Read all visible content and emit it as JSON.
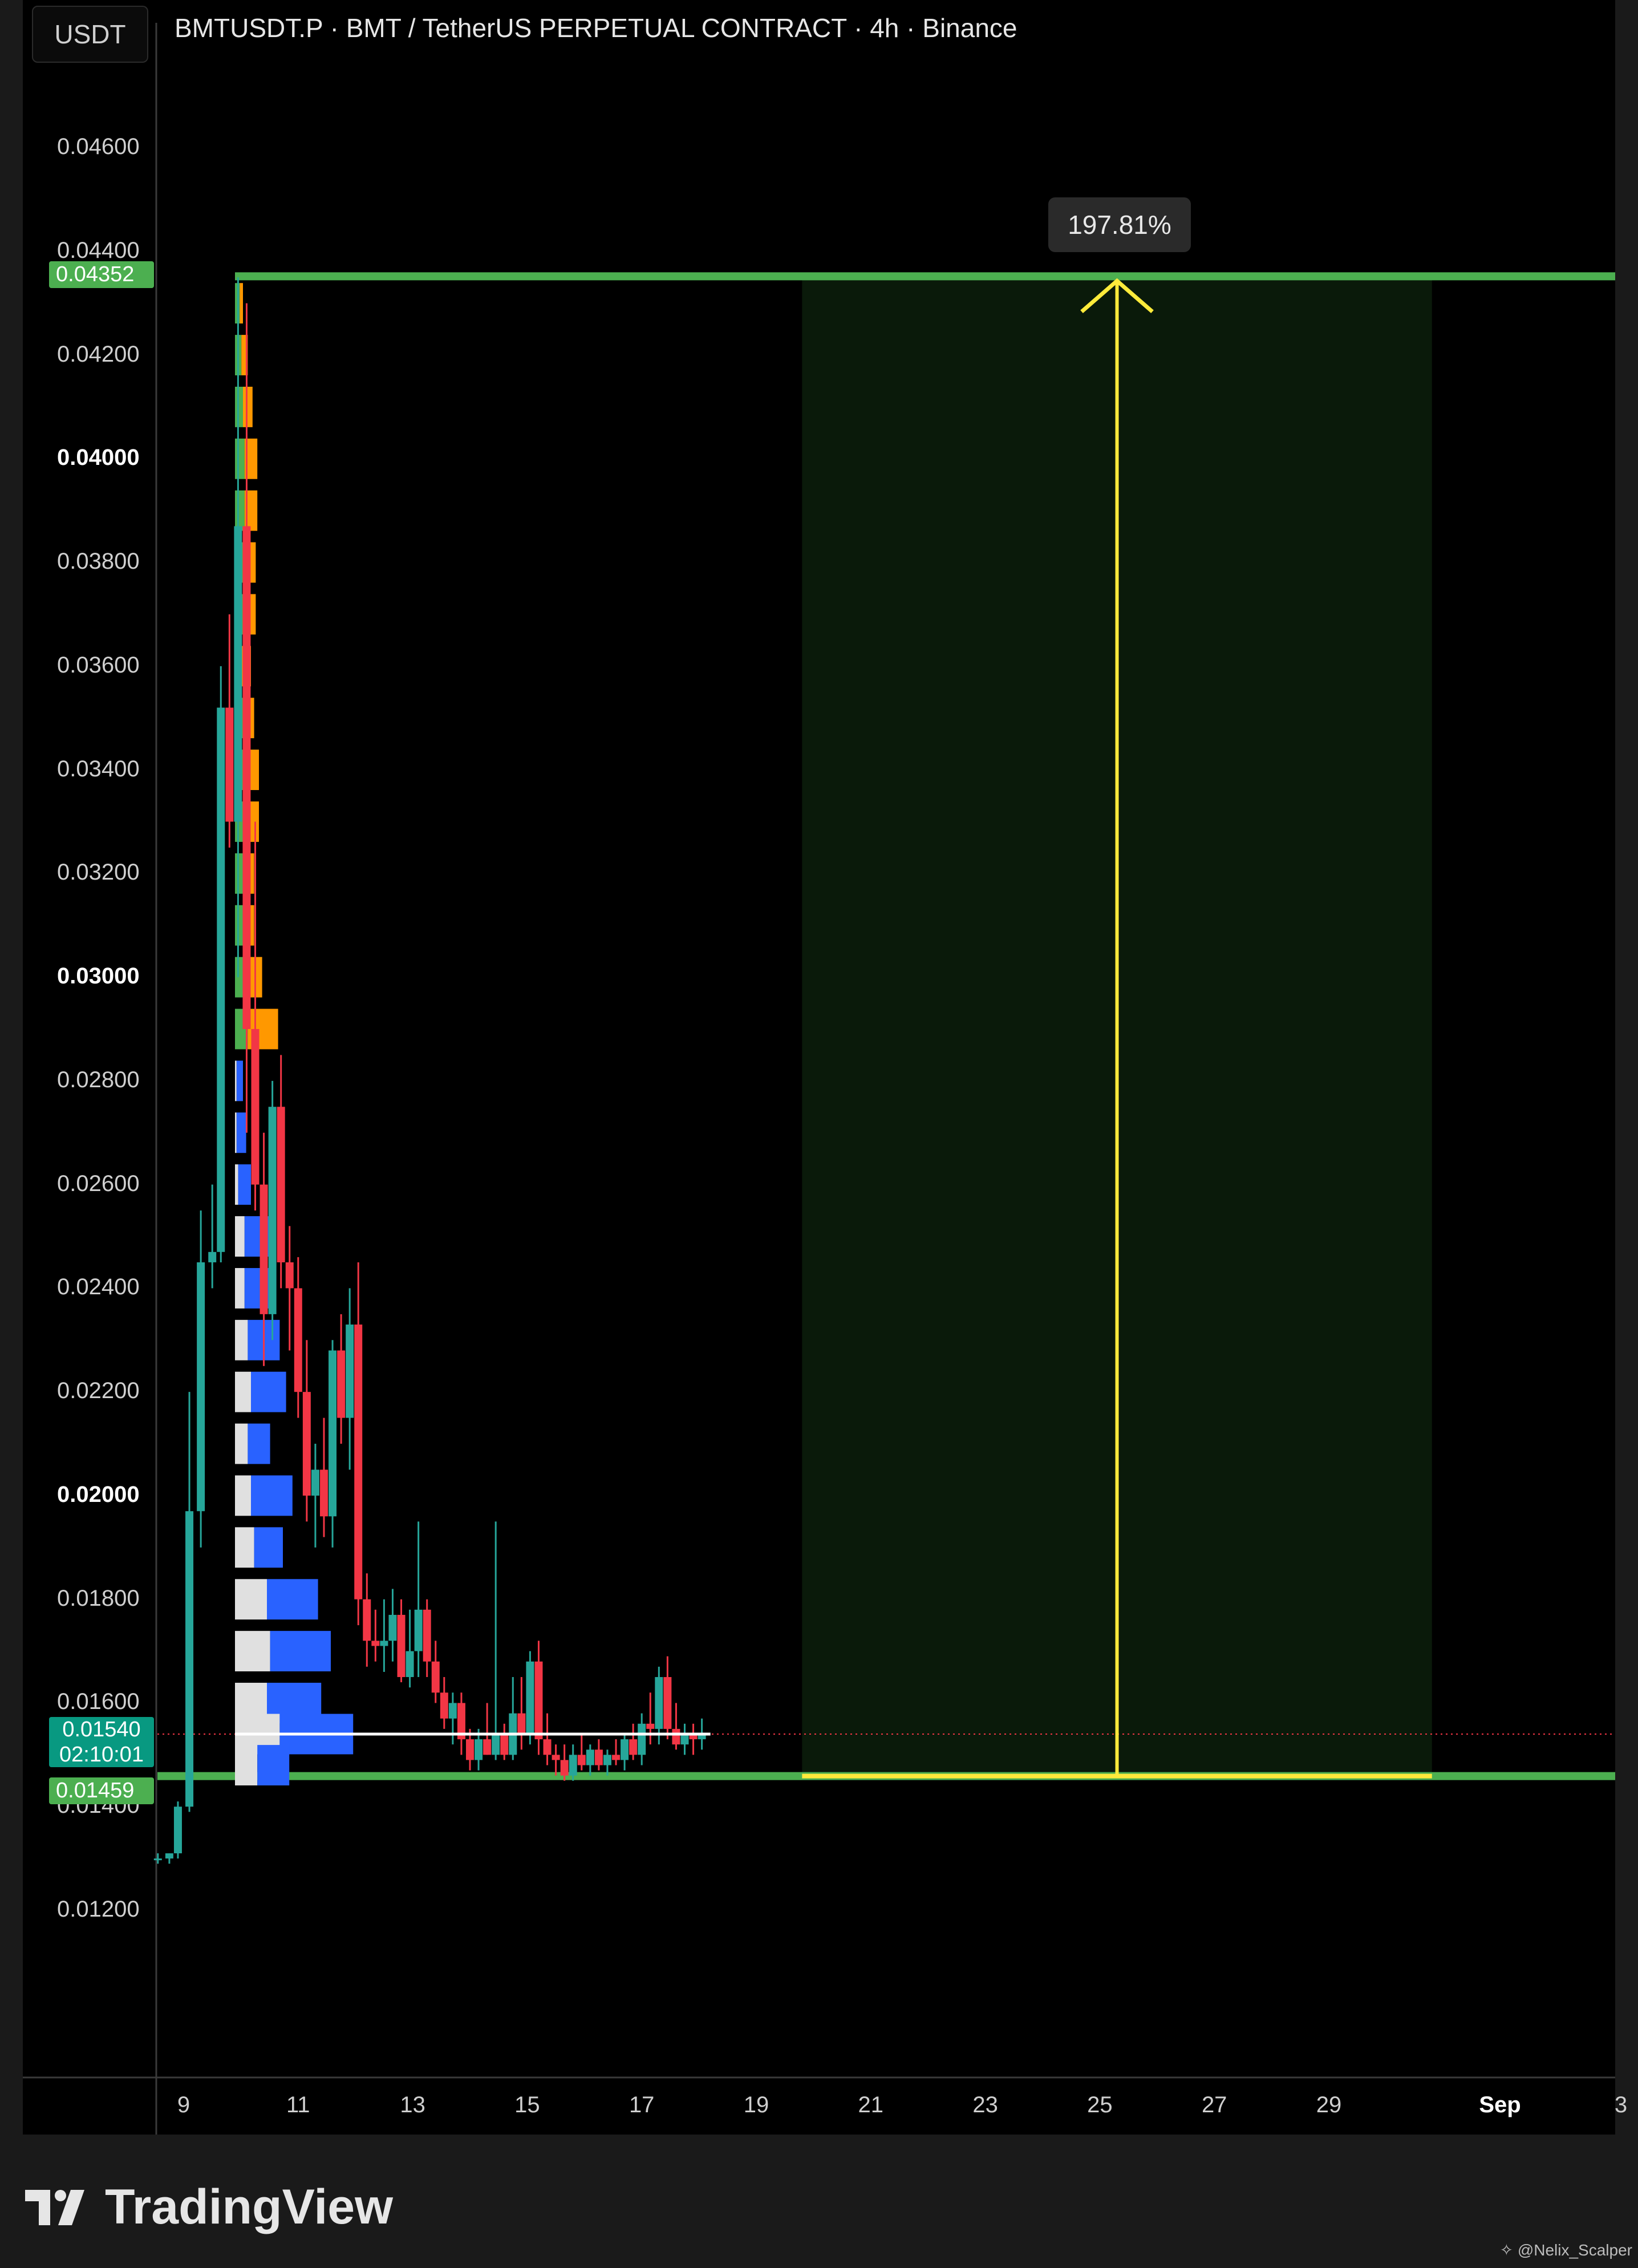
{
  "header": {
    "currency": "USDT",
    "title": "BMTUSDT.P · BMT / TetherUS PERPETUAL CONTRACT · 4h · Binance"
  },
  "chart_data": {
    "type": "candlestick",
    "title": "BMTUSDT.P · BMT / TetherUS PERPETUAL CONTRACT · 4h · Binance",
    "ylim": [
      0.0108,
      0.047
    ],
    "y_ticks": [
      {
        "label": "0.04600",
        "value": 0.046,
        "bold": false
      },
      {
        "label": "0.04400",
        "value": 0.044,
        "bold": false
      },
      {
        "label": "0.04200",
        "value": 0.042,
        "bold": false
      },
      {
        "label": "0.04000",
        "value": 0.04,
        "bold": true
      },
      {
        "label": "0.03800",
        "value": 0.038,
        "bold": false
      },
      {
        "label": "0.03600",
        "value": 0.036,
        "bold": false
      },
      {
        "label": "0.03400",
        "value": 0.034,
        "bold": false
      },
      {
        "label": "0.03200",
        "value": 0.032,
        "bold": false
      },
      {
        "label": "0.03000",
        "value": 0.03,
        "bold": true
      },
      {
        "label": "0.02800",
        "value": 0.028,
        "bold": false
      },
      {
        "label": "0.02600",
        "value": 0.026,
        "bold": false
      },
      {
        "label": "0.02400",
        "value": 0.024,
        "bold": false
      },
      {
        "label": "0.02200",
        "value": 0.022,
        "bold": false
      },
      {
        "label": "0.02000",
        "value": 0.02,
        "bold": true
      },
      {
        "label": "0.01800",
        "value": 0.018,
        "bold": false
      },
      {
        "label": "0.01600",
        "value": 0.016,
        "bold": false
      },
      {
        "label": "0.01400",
        "value": 0.014,
        "bold": false
      },
      {
        "label": "0.01200",
        "value": 0.012,
        "bold": false
      }
    ],
    "x_ticks": [
      {
        "label": "9",
        "day": 9,
        "bold": false
      },
      {
        "label": "11",
        "day": 11,
        "bold": false
      },
      {
        "label": "13",
        "day": 13,
        "bold": false
      },
      {
        "label": "15",
        "day": 15,
        "bold": false
      },
      {
        "label": "17",
        "day": 17,
        "bold": false
      },
      {
        "label": "19",
        "day": 19,
        "bold": false
      },
      {
        "label": "21",
        "day": 21,
        "bold": false
      },
      {
        "label": "23",
        "day": 23,
        "bold": false
      },
      {
        "label": "25",
        "day": 25,
        "bold": false
      },
      {
        "label": "27",
        "day": 27,
        "bold": false
      },
      {
        "label": "29",
        "day": 29,
        "bold": false
      },
      {
        "label": "Sep",
        "day": 32,
        "bold": true
      },
      {
        "label": "3",
        "day": 34,
        "bold": false
      }
    ],
    "candles": [
      {
        "t": 8.55,
        "o": 0.013,
        "h": 0.0131,
        "l": 0.0129,
        "c": 0.013
      },
      {
        "t": 8.75,
        "o": 0.013,
        "h": 0.0131,
        "l": 0.0129,
        "c": 0.0131
      },
      {
        "t": 8.9,
        "o": 0.0131,
        "h": 0.0141,
        "l": 0.013,
        "c": 0.014
      },
      {
        "t": 9.1,
        "o": 0.014,
        "h": 0.022,
        "l": 0.0139,
        "c": 0.0197
      },
      {
        "t": 9.3,
        "o": 0.0197,
        "h": 0.0255,
        "l": 0.019,
        "c": 0.0245
      },
      {
        "t": 9.5,
        "o": 0.0245,
        "h": 0.026,
        "l": 0.024,
        "c": 0.0247
      },
      {
        "t": 9.65,
        "o": 0.0247,
        "h": 0.036,
        "l": 0.0245,
        "c": 0.0352
      },
      {
        "t": 9.8,
        "o": 0.0352,
        "h": 0.037,
        "l": 0.0325,
        "c": 0.033
      },
      {
        "t": 9.95,
        "o": 0.033,
        "h": 0.0435,
        "l": 0.03,
        "c": 0.0387
      },
      {
        "t": 10.1,
        "o": 0.0387,
        "h": 0.043,
        "l": 0.027,
        "c": 0.029
      },
      {
        "t": 10.25,
        "o": 0.029,
        "h": 0.033,
        "l": 0.0255,
        "c": 0.026
      },
      {
        "t": 10.4,
        "o": 0.026,
        "h": 0.027,
        "l": 0.0225,
        "c": 0.0235
      },
      {
        "t": 10.55,
        "o": 0.0235,
        "h": 0.028,
        "l": 0.023,
        "c": 0.0275
      },
      {
        "t": 10.7,
        "o": 0.0275,
        "h": 0.0285,
        "l": 0.024,
        "c": 0.0245
      },
      {
        "t": 10.85,
        "o": 0.0245,
        "h": 0.0252,
        "l": 0.0228,
        "c": 0.024
      },
      {
        "t": 11.0,
        "o": 0.024,
        "h": 0.0246,
        "l": 0.0215,
        "c": 0.022
      },
      {
        "t": 11.15,
        "o": 0.022,
        "h": 0.023,
        "l": 0.0195,
        "c": 0.02
      },
      {
        "t": 11.3,
        "o": 0.02,
        "h": 0.021,
        "l": 0.019,
        "c": 0.0205
      },
      {
        "t": 11.45,
        "o": 0.0205,
        "h": 0.0215,
        "l": 0.0192,
        "c": 0.0196
      },
      {
        "t": 11.6,
        "o": 0.0196,
        "h": 0.023,
        "l": 0.019,
        "c": 0.0228
      },
      {
        "t": 11.75,
        "o": 0.0228,
        "h": 0.0235,
        "l": 0.021,
        "c": 0.0215
      },
      {
        "t": 11.9,
        "o": 0.0215,
        "h": 0.024,
        "l": 0.0205,
        "c": 0.0233
      },
      {
        "t": 12.05,
        "o": 0.0233,
        "h": 0.0245,
        "l": 0.0175,
        "c": 0.018
      },
      {
        "t": 12.2,
        "o": 0.018,
        "h": 0.0185,
        "l": 0.0167,
        "c": 0.0172
      },
      {
        "t": 12.35,
        "o": 0.0172,
        "h": 0.0178,
        "l": 0.0168,
        "c": 0.0171
      },
      {
        "t": 12.5,
        "o": 0.0171,
        "h": 0.018,
        "l": 0.0166,
        "c": 0.0172
      },
      {
        "t": 12.65,
        "o": 0.0172,
        "h": 0.0182,
        "l": 0.0168,
        "c": 0.0177
      },
      {
        "t": 12.8,
        "o": 0.0177,
        "h": 0.018,
        "l": 0.0164,
        "c": 0.0165
      },
      {
        "t": 12.95,
        "o": 0.0165,
        "h": 0.0178,
        "l": 0.0163,
        "c": 0.017
      },
      {
        "t": 13.1,
        "o": 0.017,
        "h": 0.0195,
        "l": 0.0165,
        "c": 0.0178
      },
      {
        "t": 13.25,
        "o": 0.0178,
        "h": 0.018,
        "l": 0.0165,
        "c": 0.0168
      },
      {
        "t": 13.4,
        "o": 0.0168,
        "h": 0.0172,
        "l": 0.016,
        "c": 0.0162
      },
      {
        "t": 13.55,
        "o": 0.0162,
        "h": 0.0165,
        "l": 0.0155,
        "c": 0.0157
      },
      {
        "t": 13.7,
        "o": 0.0157,
        "h": 0.0162,
        "l": 0.0152,
        "c": 0.016
      },
      {
        "t": 13.85,
        "o": 0.016,
        "h": 0.0162,
        "l": 0.015,
        "c": 0.0153
      },
      {
        "t": 14.0,
        "o": 0.0153,
        "h": 0.0155,
        "l": 0.0147,
        "c": 0.0149
      },
      {
        "t": 14.15,
        "o": 0.0149,
        "h": 0.0155,
        "l": 0.0147,
        "c": 0.0153
      },
      {
        "t": 14.3,
        "o": 0.0153,
        "h": 0.016,
        "l": 0.015,
        "c": 0.015
      },
      {
        "t": 14.45,
        "o": 0.015,
        "h": 0.0195,
        "l": 0.0149,
        "c": 0.0154
      },
      {
        "t": 14.6,
        "o": 0.0154,
        "h": 0.0156,
        "l": 0.0149,
        "c": 0.015
      },
      {
        "t": 14.75,
        "o": 0.015,
        "h": 0.0165,
        "l": 0.0149,
        "c": 0.0158
      },
      {
        "t": 14.9,
        "o": 0.0158,
        "h": 0.0165,
        "l": 0.0151,
        "c": 0.0154
      },
      {
        "t": 15.05,
        "o": 0.0154,
        "h": 0.017,
        "l": 0.0152,
        "c": 0.0168
      },
      {
        "t": 15.2,
        "o": 0.0168,
        "h": 0.0172,
        "l": 0.015,
        "c": 0.0153
      },
      {
        "t": 15.35,
        "o": 0.0153,
        "h": 0.0158,
        "l": 0.0148,
        "c": 0.015
      },
      {
        "t": 15.5,
        "o": 0.015,
        "h": 0.0152,
        "l": 0.0146,
        "c": 0.0149
      },
      {
        "t": 15.65,
        "o": 0.0149,
        "h": 0.0152,
        "l": 0.0145,
        "c": 0.0146
      },
      {
        "t": 15.8,
        "o": 0.0146,
        "h": 0.0152,
        "l": 0.0145,
        "c": 0.015
      },
      {
        "t": 15.95,
        "o": 0.015,
        "h": 0.0154,
        "l": 0.0147,
        "c": 0.0148
      },
      {
        "t": 16.1,
        "o": 0.0148,
        "h": 0.0152,
        "l": 0.0146,
        "c": 0.0151
      },
      {
        "t": 16.25,
        "o": 0.0151,
        "h": 0.0153,
        "l": 0.0147,
        "c": 0.0148
      },
      {
        "t": 16.4,
        "o": 0.0148,
        "h": 0.0151,
        "l": 0.0146,
        "c": 0.015
      },
      {
        "t": 16.55,
        "o": 0.015,
        "h": 0.0153,
        "l": 0.0148,
        "c": 0.0149
      },
      {
        "t": 16.7,
        "o": 0.0149,
        "h": 0.0154,
        "l": 0.0147,
        "c": 0.0153
      },
      {
        "t": 16.85,
        "o": 0.0153,
        "h": 0.0156,
        "l": 0.0149,
        "c": 0.015
      },
      {
        "t": 17.0,
        "o": 0.015,
        "h": 0.0158,
        "l": 0.0148,
        "c": 0.0156
      },
      {
        "t": 17.15,
        "o": 0.0156,
        "h": 0.0162,
        "l": 0.0152,
        "c": 0.0155
      },
      {
        "t": 17.3,
        "o": 0.0155,
        "h": 0.0167,
        "l": 0.0152,
        "c": 0.0165
      },
      {
        "t": 17.45,
        "o": 0.0165,
        "h": 0.0169,
        "l": 0.0153,
        "c": 0.0155
      },
      {
        "t": 17.6,
        "o": 0.0155,
        "h": 0.016,
        "l": 0.0151,
        "c": 0.0152
      },
      {
        "t": 17.75,
        "o": 0.0152,
        "h": 0.0156,
        "l": 0.015,
        "c": 0.0154
      },
      {
        "t": 17.9,
        "o": 0.0154,
        "h": 0.0156,
        "l": 0.015,
        "c": 0.0153
      },
      {
        "t": 18.05,
        "o": 0.0153,
        "h": 0.0157,
        "l": 0.0151,
        "c": 0.0154
      }
    ],
    "volume_profile": [
      {
        "p": 0.043,
        "up": 0.3,
        "dn": 0.2,
        "scheme": "orange"
      },
      {
        "p": 0.042,
        "up": 0.4,
        "dn": 0.4,
        "scheme": "orange"
      },
      {
        "p": 0.041,
        "up": 0.5,
        "dn": 0.6,
        "scheme": "orange"
      },
      {
        "p": 0.04,
        "up": 0.6,
        "dn": 0.8,
        "scheme": "orange"
      },
      {
        "p": 0.039,
        "up": 0.6,
        "dn": 0.8,
        "scheme": "orange"
      },
      {
        "p": 0.038,
        "up": 0.5,
        "dn": 0.8,
        "scheme": "orange"
      },
      {
        "p": 0.037,
        "up": 0.5,
        "dn": 0.8,
        "scheme": "orange"
      },
      {
        "p": 0.036,
        "up": 0.4,
        "dn": 0.6,
        "scheme": "orange"
      },
      {
        "p": 0.035,
        "up": 0.5,
        "dn": 0.7,
        "scheme": "orange"
      },
      {
        "p": 0.034,
        "up": 0.6,
        "dn": 0.9,
        "scheme": "orange"
      },
      {
        "p": 0.033,
        "up": 0.6,
        "dn": 0.9,
        "scheme": "orange"
      },
      {
        "p": 0.032,
        "up": 0.5,
        "dn": 0.7,
        "scheme": "orange"
      },
      {
        "p": 0.031,
        "up": 0.5,
        "dn": 0.7,
        "scheme": "orange"
      },
      {
        "p": 0.03,
        "up": 0.6,
        "dn": 1.1,
        "scheme": "orange"
      },
      {
        "p": 0.029,
        "up": 0.8,
        "dn": 1.9,
        "scheme": "orange"
      },
      {
        "p": 0.028,
        "up": 0.1,
        "dn": 0.4,
        "scheme": "blue"
      },
      {
        "p": 0.027,
        "up": 0.1,
        "dn": 0.6,
        "scheme": "blue"
      },
      {
        "p": 0.026,
        "up": 0.2,
        "dn": 0.8,
        "scheme": "blue"
      },
      {
        "p": 0.025,
        "up": 0.6,
        "dn": 1.8,
        "scheme": "blue"
      },
      {
        "p": 0.024,
        "up": 0.6,
        "dn": 1.6,
        "scheme": "blue"
      },
      {
        "p": 0.023,
        "up": 0.8,
        "dn": 2.0,
        "scheme": "blue"
      },
      {
        "p": 0.022,
        "up": 1.0,
        "dn": 2.2,
        "scheme": "blue"
      },
      {
        "p": 0.021,
        "up": 0.8,
        "dn": 1.4,
        "scheme": "blue"
      },
      {
        "p": 0.02,
        "up": 1.0,
        "dn": 2.6,
        "scheme": "blue"
      },
      {
        "p": 0.019,
        "up": 1.2,
        "dn": 1.8,
        "scheme": "blue"
      },
      {
        "p": 0.018,
        "up": 2.0,
        "dn": 3.2,
        "scheme": "blue"
      },
      {
        "p": 0.017,
        "up": 2.2,
        "dn": 3.8,
        "scheme": "blue"
      },
      {
        "p": 0.016,
        "up": 2.0,
        "dn": 3.4,
        "scheme": "blue"
      },
      {
        "p": 0.0154,
        "up": 2.8,
        "dn": 4.6,
        "scheme": "blue"
      },
      {
        "p": 0.0148,
        "up": 1.4,
        "dn": 2.0,
        "scheme": "blue"
      }
    ],
    "levels": [
      {
        "name": "target",
        "price": 0.04352,
        "color": "#4CAF50"
      },
      {
        "name": "support",
        "price": 0.01459,
        "color": "#4CAF50"
      }
    ],
    "current_price": {
      "price": 0.0154,
      "countdown": "02:10:01"
    },
    "measure": {
      "label": "197.81%",
      "from_price": 0.01459,
      "to_price": 0.04352,
      "from_day": 19.8,
      "to_day": 30.8,
      "arrow_day": 25.3
    },
    "price_tags": {
      "target": "0.04352",
      "current": "0.01540",
      "support": "0.01459"
    },
    "colors": {
      "up": "#26A69A",
      "down": "#F23645",
      "level": "#4CAF50",
      "measure": "#FFEB3B",
      "profile_up_orange": "#4CAF50",
      "profile_dn_orange": "#FF9800",
      "profile_up_blue": "#E0E0E0",
      "profile_dn_blue": "#2962FF"
    }
  },
  "footer": {
    "brand": "TradingView",
    "credit": "@Nelix_Scalper"
  }
}
